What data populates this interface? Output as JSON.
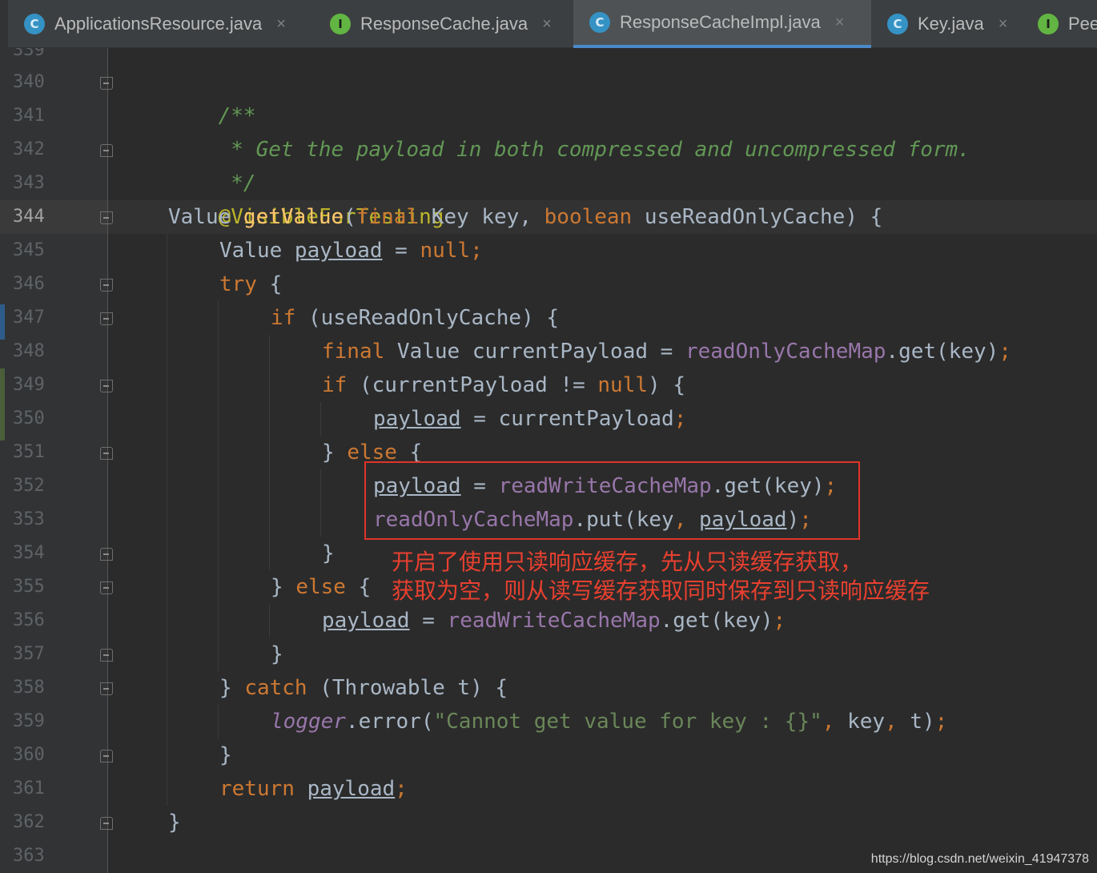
{
  "tabs": [
    {
      "label": "ApplicationsResource.java",
      "type": "C",
      "active": false
    },
    {
      "label": "ResponseCache.java",
      "type": "I",
      "active": false
    },
    {
      "label": "ResponseCacheImpl.java",
      "type": "C",
      "active": true
    },
    {
      "label": "Key.java",
      "type": "C",
      "active": false
    },
    {
      "label": "Pee",
      "type": "I",
      "active": false
    }
  ],
  "close_glyph": "×",
  "line_numbers": [
    "339",
    "340",
    "341",
    "342",
    "343",
    "344",
    "345",
    "346",
    "347",
    "348",
    "349",
    "350",
    "351",
    "352",
    "353",
    "354",
    "355",
    "356",
    "357",
    "358",
    "359",
    "360",
    "361",
    "362",
    "363"
  ],
  "current_line": "344",
  "code": {
    "l340": {
      "a": "/**"
    },
    "l341": {
      "a": " * Get the payload in both compressed and uncompressed form."
    },
    "l342": {
      "a": " */"
    },
    "l343": {
      "a": "@VisibleForTesting"
    },
    "l344": {
      "a": "Value ",
      "b": "getValue",
      "c": "(",
      "d": "final",
      "e": " Key key, ",
      "f": "boolean",
      "g": " useReadOnlyCache) {"
    },
    "l345": {
      "a": "Value ",
      "b": "payload",
      "c": " = ",
      "d": "null",
      "e": ";"
    },
    "l346": {
      "a": "try",
      "b": " {"
    },
    "l347": {
      "a": "if",
      "b": " (useReadOnlyCache) {"
    },
    "l348": {
      "a": "final",
      "b": " Value currentPayload = ",
      "c": "readOnlyCacheMap",
      "d": ".get(key)",
      "e": ";"
    },
    "l349": {
      "a": "if",
      "b": " (currentPayload != ",
      "c": "null",
      "d": ") {"
    },
    "l350": {
      "a": "payload",
      "b": " = currentPayload",
      "c": ";"
    },
    "l351": {
      "a": "} ",
      "b": "else",
      "c": " {"
    },
    "l352": {
      "a": "payload",
      "b": " = ",
      "c": "readWriteCacheMap",
      "d": ".get(key)",
      "e": ";"
    },
    "l353": {
      "a": "readOnlyCacheMap",
      "b": ".put(key",
      "c": ",",
      "d": " ",
      "e": "payload",
      "f": ")",
      "g": ";"
    },
    "l354": {
      "a": "}"
    },
    "l355": {
      "a": "} ",
      "b": "else",
      "c": " {"
    },
    "l356": {
      "a": "payload",
      "b": " = ",
      "c": "readWriteCacheMap",
      "d": ".get(key)",
      "e": ";"
    },
    "l357": {
      "a": "}"
    },
    "l358": {
      "a": "} ",
      "b": "catch",
      "c": " (Throwable t) {"
    },
    "l359": {
      "a": "logger",
      "b": ".error(",
      "c": "\"Cannot get value for key : {}\"",
      "d": ",",
      "e": " key",
      "f": ",",
      "g": " t)",
      "h": ";"
    },
    "l360": {
      "a": "}"
    },
    "l361": {
      "a": "return",
      "b": " ",
      "c": "payload",
      "d": ";"
    },
    "l362": {
      "a": "}"
    }
  },
  "annotation": {
    "line1": "开启了使用只读响应缓存，先从只读缓存获取，",
    "line2": "获取为空，则从读写缓存获取同时保存到只读响应缓存"
  },
  "watermark": "https://blog.csdn.net/weixin_41947378",
  "colors": {
    "keyword": "#cc7832",
    "field": "#9876aa",
    "method": "#ffc66d",
    "comment": "#629755",
    "annotation_box": "#e0342a"
  }
}
